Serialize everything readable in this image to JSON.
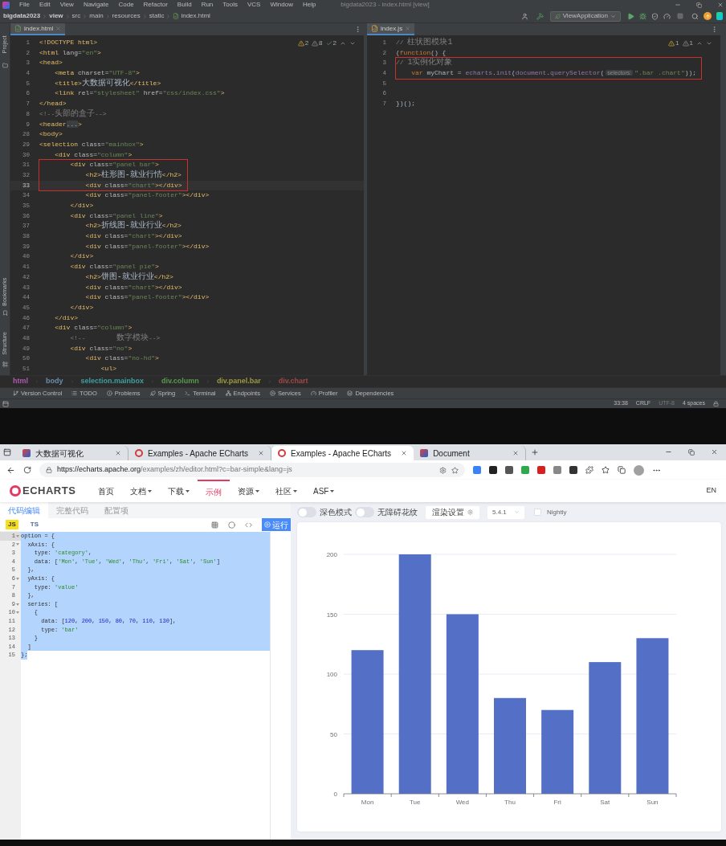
{
  "ide": {
    "menu": [
      "File",
      "Edit",
      "View",
      "Navigate",
      "Code",
      "Refactor",
      "Build",
      "Run",
      "Tools",
      "VCS",
      "Window",
      "Help"
    ],
    "window_title": "bigdata2023 - index.html [view]",
    "path": [
      "bigdata2023",
      "view",
      "src",
      "main",
      "resources",
      "static",
      "index.html"
    ],
    "run_config": "ViewApplication",
    "side_tools": [
      "Project",
      "Bookmarks",
      "Structure"
    ],
    "editors": [
      {
        "tab": "index.html",
        "inspections": [
          {
            "kind": "warning",
            "count": "2"
          },
          {
            "kind": "weak",
            "count": "8"
          },
          {
            "kind": "ok",
            "count": "2"
          }
        ],
        "lines": [
          {
            "number": "1",
            "current": false,
            "boxed": false,
            "segments": [
              {
                "kind": "tag",
                "text": "<!DOCTYPE html>"
              }
            ]
          },
          {
            "number": "2",
            "current": false,
            "boxed": false,
            "segments": [
              {
                "kind": "tag",
                "text": "<html"
              },
              {
                "kind": "attr",
                "text": " lang="
              },
              {
                "kind": "string",
                "text": "\"en\""
              },
              {
                "kind": "tag",
                "text": ">"
              }
            ]
          },
          {
            "number": "3",
            "current": false,
            "boxed": false,
            "segments": [
              {
                "kind": "tag",
                "text": "<head>"
              }
            ]
          },
          {
            "number": "4",
            "current": false,
            "boxed": false,
            "segments": [
              {
                "kind": "tag",
                "text": "    <meta"
              },
              {
                "kind": "attr",
                "text": " charset="
              },
              {
                "kind": "string",
                "text": "\"UTF-8\""
              },
              {
                "kind": "tag",
                "text": ">"
              }
            ]
          },
          {
            "number": "5",
            "current": false,
            "boxed": false,
            "segments": [
              {
                "kind": "tag",
                "text": "    <title>"
              },
              {
                "kind": "text",
                "text": "大数据可视化"
              },
              {
                "kind": "tag",
                "text": "</title>"
              }
            ]
          },
          {
            "number": "6",
            "current": false,
            "boxed": false,
            "segments": [
              {
                "kind": "tag",
                "text": "    <link"
              },
              {
                "kind": "attr",
                "text": " rel="
              },
              {
                "kind": "string",
                "text": "\"stylesheet\""
              },
              {
                "kind": "attr",
                "text": " href="
              },
              {
                "kind": "string",
                "text": "\"css/index.css\""
              },
              {
                "kind": "tag",
                "text": ">"
              }
            ]
          },
          {
            "number": "7",
            "current": false,
            "boxed": false,
            "segments": [
              {
                "kind": "tag",
                "text": "</head>"
              }
            ]
          },
          {
            "number": "8",
            "current": false,
            "boxed": false,
            "segments": [
              {
                "kind": "comment",
                "text": "<!--"
              },
              {
                "kind": "comment_text",
                "text": "头部的盒子"
              },
              {
                "kind": "comment",
                "text": "-->"
              }
            ]
          },
          {
            "number": "9",
            "current": false,
            "boxed": false,
            "segments": [
              {
                "kind": "tag",
                "text": "<header"
              },
              {
                "kind": "fold",
                "text": "..."
              },
              {
                "kind": "tag",
                "text": ">"
              }
            ]
          },
          {
            "number": "28",
            "current": false,
            "boxed": false,
            "segments": [
              {
                "kind": "tag",
                "text": "<body>"
              }
            ]
          },
          {
            "number": "29",
            "current": false,
            "boxed": false,
            "segments": [
              {
                "kind": "tag",
                "text": "<selection"
              },
              {
                "kind": "attr",
                "text": " class="
              },
              {
                "kind": "string",
                "text": "\"mainbox\""
              },
              {
                "kind": "tag",
                "text": ">"
              }
            ]
          },
          {
            "number": "30",
            "current": false,
            "boxed": false,
            "segments": [
              {
                "kind": "tag",
                "text": "    <div"
              },
              {
                "kind": "attr",
                "text": " class="
              },
              {
                "kind": "string",
                "text": "\"column\""
              },
              {
                "kind": "tag",
                "text": ">"
              }
            ]
          },
          {
            "number": "31",
            "current": false,
            "boxed": true,
            "segments": [
              {
                "kind": "tag",
                "text": "        <div"
              },
              {
                "kind": "attr",
                "text": " class="
              },
              {
                "kind": "string",
                "text": "\"panel bar\""
              },
              {
                "kind": "tag",
                "text": ">"
              }
            ]
          },
          {
            "number": "32",
            "current": false,
            "boxed": true,
            "segments": [
              {
                "kind": "tag",
                "text": "            <h2>"
              },
              {
                "kind": "text",
                "text": "柱形图-就业行情"
              },
              {
                "kind": "tag",
                "text": "</h2>"
              }
            ]
          },
          {
            "number": "33",
            "current": true,
            "boxed": true,
            "segments": [
              {
                "kind": "tag",
                "text": "            <div"
              },
              {
                "kind": "attr",
                "text": " class="
              },
              {
                "kind": "string",
                "text": "\"chart\""
              },
              {
                "kind": "tag",
                "text": "></div>"
              }
            ]
          },
          {
            "number": "34",
            "current": false,
            "boxed": false,
            "segments": [
              {
                "kind": "tag",
                "text": "            <div"
              },
              {
                "kind": "attr",
                "text": " class="
              },
              {
                "kind": "string",
                "text": "\"panel-footer\""
              },
              {
                "kind": "tag",
                "text": "></div>"
              }
            ]
          },
          {
            "number": "35",
            "current": false,
            "boxed": false,
            "segments": [
              {
                "kind": "tag",
                "text": "        </div>"
              }
            ]
          },
          {
            "number": "36",
            "current": false,
            "boxed": false,
            "segments": [
              {
                "kind": "tag",
                "text": "        <div"
              },
              {
                "kind": "attr",
                "text": " class="
              },
              {
                "kind": "string",
                "text": "\"panel line\""
              },
              {
                "kind": "tag",
                "text": ">"
              }
            ]
          },
          {
            "number": "37",
            "current": false,
            "boxed": false,
            "segments": [
              {
                "kind": "tag",
                "text": "            <h2>"
              },
              {
                "kind": "text",
                "text": "折线图-就业行业"
              },
              {
                "kind": "tag",
                "text": "</h2>"
              }
            ]
          },
          {
            "number": "38",
            "current": false,
            "boxed": false,
            "segments": [
              {
                "kind": "tag",
                "text": "            <div"
              },
              {
                "kind": "attr",
                "text": " class="
              },
              {
                "kind": "string",
                "text": "\"chart\""
              },
              {
                "kind": "tag",
                "text": "></div>"
              }
            ]
          },
          {
            "number": "39",
            "current": false,
            "boxed": false,
            "segments": [
              {
                "kind": "tag",
                "text": "            <div"
              },
              {
                "kind": "attr",
                "text": " class="
              },
              {
                "kind": "string",
                "text": "\"panel-footer\""
              },
              {
                "kind": "tag",
                "text": "></div>"
              }
            ]
          },
          {
            "number": "40",
            "current": false,
            "boxed": false,
            "segments": [
              {
                "kind": "tag",
                "text": "        </div>"
              }
            ]
          },
          {
            "number": "41",
            "current": false,
            "boxed": false,
            "segments": [
              {
                "kind": "tag",
                "text": "        <div"
              },
              {
                "kind": "attr",
                "text": " class="
              },
              {
                "kind": "string",
                "text": "\"panel pie\""
              },
              {
                "kind": "tag",
                "text": ">"
              }
            ]
          },
          {
            "number": "42",
            "current": false,
            "boxed": false,
            "segments": [
              {
                "kind": "tag",
                "text": "            <h2>"
              },
              {
                "kind": "text",
                "text": "饼图-就业行业"
              },
              {
                "kind": "tag",
                "text": "</h2>"
              }
            ]
          },
          {
            "number": "43",
            "current": false,
            "boxed": false,
            "segments": [
              {
                "kind": "tag",
                "text": "            <div"
              },
              {
                "kind": "attr",
                "text": " class="
              },
              {
                "kind": "string",
                "text": "\"chart\""
              },
              {
                "kind": "tag",
                "text": "></div>"
              }
            ]
          },
          {
            "number": "44",
            "current": false,
            "boxed": false,
            "segments": [
              {
                "kind": "tag",
                "text": "            <div"
              },
              {
                "kind": "attr",
                "text": " class="
              },
              {
                "kind": "string",
                "text": "\"panel-footer\""
              },
              {
                "kind": "tag",
                "text": "></div>"
              }
            ]
          },
          {
            "number": "45",
            "current": false,
            "boxed": false,
            "segments": [
              {
                "kind": "tag",
                "text": "        </div>"
              }
            ]
          },
          {
            "number": "46",
            "current": false,
            "boxed": false,
            "segments": [
              {
                "kind": "tag",
                "text": "    </div>"
              }
            ]
          },
          {
            "number": "47",
            "current": false,
            "boxed": false,
            "segments": [
              {
                "kind": "tag",
                "text": "    <div"
              },
              {
                "kind": "attr",
                "text": " class="
              },
              {
                "kind": "string",
                "text": "\"column\""
              },
              {
                "kind": "tag",
                "text": ">"
              }
            ]
          },
          {
            "number": "48",
            "current": false,
            "boxed": false,
            "segments": [
              {
                "kind": "comment",
                "text": "        <!--        "
              },
              {
                "kind": "comment_text",
                "text": "数字模块"
              },
              {
                "kind": "comment",
                "text": "-->"
              }
            ]
          },
          {
            "number": "49",
            "current": false,
            "boxed": false,
            "segments": [
              {
                "kind": "tag",
                "text": "        <div"
              },
              {
                "kind": "attr",
                "text": " class="
              },
              {
                "kind": "string",
                "text": "\"no\""
              },
              {
                "kind": "tag",
                "text": ">"
              }
            ]
          },
          {
            "number": "50",
            "current": false,
            "boxed": false,
            "segments": [
              {
                "kind": "tag",
                "text": "            <div"
              },
              {
                "kind": "attr",
                "text": " class="
              },
              {
                "kind": "string",
                "text": "\"no-hd\""
              },
              {
                "kind": "tag",
                "text": ">"
              }
            ]
          },
          {
            "number": "51",
            "current": false,
            "boxed": false,
            "segments": [
              {
                "kind": "tag",
                "text": "                <ul>"
              }
            ]
          }
        ]
      },
      {
        "tab": "index.js",
        "inspections": [
          {
            "kind": "warning",
            "count": "1"
          },
          {
            "kind": "weak",
            "count": "1"
          }
        ],
        "lines": [
          {
            "number": "1",
            "current": false,
            "boxed": false,
            "segments": [
              {
                "kind": "comment",
                "text": "// "
              },
              {
                "kind": "comment_text",
                "text": "柱状图模块1"
              }
            ]
          },
          {
            "number": "2",
            "current": false,
            "boxed": false,
            "segments": [
              {
                "kind": "punct",
                "text": "("
              },
              {
                "kind": "keyword",
                "text": "function"
              },
              {
                "kind": "punct",
                "text": "() {"
              }
            ]
          },
          {
            "number": "3",
            "current": false,
            "boxed": true,
            "segments": [
              {
                "kind": "comment",
                "text": "// "
              },
              {
                "kind": "comment_text",
                "text": "1实例化对象"
              }
            ]
          },
          {
            "number": "4",
            "current": false,
            "boxed": true,
            "segments": [
              {
                "kind": "keyword",
                "text": "    var"
              },
              {
                "kind": "punct",
                "text": " myChart = "
              },
              {
                "kind": "object",
                "text": "echarts"
              },
              {
                "kind": "punct",
                "text": "."
              },
              {
                "kind": "object",
                "text": "init"
              },
              {
                "kind": "punct",
                "text": "("
              },
              {
                "kind": "object",
                "text": "document"
              },
              {
                "kind": "punct",
                "text": "."
              },
              {
                "kind": "object",
                "text": "querySelector"
              },
              {
                "kind": "punct",
                "text": "("
              },
              {
                "kind": "hint",
                "text": "selectors:"
              },
              {
                "kind": "string",
                "text": "\".bar .chart\""
              },
              {
                "kind": "punct",
                "text": "));"
              }
            ]
          },
          {
            "number": "5",
            "current": false,
            "boxed": false
          },
          {
            "number": "6",
            "current": false,
            "boxed": false
          },
          {
            "number": "7",
            "current": false,
            "boxed": false,
            "segments": [
              {
                "kind": "punct",
                "text": "})();"
              }
            ]
          }
        ]
      }
    ],
    "structure_path": [
      {
        "text": "html",
        "color": "#b05ab0"
      },
      {
        "text": "body",
        "color": "#6a8cb0"
      },
      {
        "text": "selection.mainbox",
        "color": "#3f9fa0"
      },
      {
        "text": "div.column",
        "color": "#5a9a50"
      },
      {
        "text": "div.panel.bar",
        "color": "#9a9a40"
      },
      {
        "text": "div.chart",
        "color": "#a04848"
      }
    ],
    "tool_windows": [
      "Version Control",
      "TODO",
      "Problems",
      "Spring",
      "Terminal",
      "Endpoints",
      "Services",
      "Profiler",
      "Dependencies"
    ],
    "status": [
      "33:38",
      "CRLF",
      "UTF-8",
      "4 spaces"
    ]
  },
  "browser": {
    "tabs": [
      {
        "title": "大数据可视化",
        "kind": "app",
        "selected": false
      },
      {
        "title": "Examples - Apache ECharts",
        "kind": "echarts",
        "selected": false
      },
      {
        "title": "Examples - Apache ECharts",
        "kind": "echarts",
        "selected": true
      },
      {
        "title": "Document",
        "kind": "app",
        "selected": false
      }
    ],
    "url_host": "https://echarts.apache.org",
    "url_path": "/examples/zh/editor.html?c=bar-simple&lang=js"
  },
  "site": {
    "logo": "ECHARTS",
    "nav": [
      {
        "label": "首页",
        "dropdown": false,
        "selected": false
      },
      {
        "label": "文档",
        "dropdown": true,
        "selected": false
      },
      {
        "label": "下载",
        "dropdown": true,
        "selected": false
      },
      {
        "label": "示例",
        "dropdown": false,
        "selected": true
      },
      {
        "label": "资源",
        "dropdown": true,
        "selected": false
      },
      {
        "label": "社区",
        "dropdown": true,
        "selected": false
      },
      {
        "label": "ASF",
        "dropdown": true,
        "selected": false
      }
    ],
    "language": "EN"
  },
  "editor_panel": {
    "tabs": [
      {
        "label": "代码编辑",
        "selected": true
      },
      {
        "label": "完整代码",
        "selected": false
      },
      {
        "label": "配置项",
        "selected": false
      }
    ],
    "languages": [
      {
        "label": "JS",
        "selected": true
      },
      {
        "label": "TS",
        "selected": false
      }
    ],
    "run_button": "运行",
    "all_selected": true,
    "lines": [
      {
        "number": "1",
        "foldable": true,
        "segments": [
          {
            "kind": "plain",
            "text": "option = {"
          }
        ]
      },
      {
        "number": "2",
        "foldable": true,
        "segments": [
          {
            "kind": "plain",
            "text": "  xAxis: {"
          }
        ]
      },
      {
        "number": "3",
        "foldable": false,
        "segments": [
          {
            "kind": "plain",
            "text": "    type: "
          },
          {
            "kind": "string",
            "text": "'category'"
          },
          {
            "kind": "plain",
            "text": ","
          }
        ]
      },
      {
        "number": "4",
        "foldable": false,
        "segments": [
          {
            "kind": "plain",
            "text": "    data: ["
          },
          {
            "kind": "string",
            "text": "'Mon'"
          },
          {
            "kind": "plain",
            "text": ", "
          },
          {
            "kind": "string",
            "text": "'Tue'"
          },
          {
            "kind": "plain",
            "text": ", "
          },
          {
            "kind": "string",
            "text": "'Wed'"
          },
          {
            "kind": "plain",
            "text": ", "
          },
          {
            "kind": "string",
            "text": "'Thu'"
          },
          {
            "kind": "plain",
            "text": ", "
          },
          {
            "kind": "string",
            "text": "'Fri'"
          },
          {
            "kind": "plain",
            "text": ", "
          },
          {
            "kind": "string",
            "text": "'Sat'"
          },
          {
            "kind": "plain",
            "text": ", "
          },
          {
            "kind": "string",
            "text": "'Sun'"
          },
          {
            "kind": "plain",
            "text": "]"
          }
        ]
      },
      {
        "number": "5",
        "foldable": false,
        "segments": [
          {
            "kind": "plain",
            "text": "  },"
          }
        ]
      },
      {
        "number": "6",
        "foldable": true,
        "segments": [
          {
            "kind": "plain",
            "text": "  yAxis: {"
          }
        ]
      },
      {
        "number": "7",
        "foldable": false,
        "segments": [
          {
            "kind": "plain",
            "text": "    type: "
          },
          {
            "kind": "string",
            "text": "'value'"
          }
        ]
      },
      {
        "number": "8",
        "foldable": false,
        "segments": [
          {
            "kind": "plain",
            "text": "  },"
          }
        ]
      },
      {
        "number": "9",
        "foldable": true,
        "segments": [
          {
            "kind": "plain",
            "text": "  series: ["
          }
        ]
      },
      {
        "number": "10",
        "foldable": true,
        "segments": [
          {
            "kind": "plain",
            "text": "    {"
          }
        ]
      },
      {
        "number": "11",
        "foldable": false,
        "segments": [
          {
            "kind": "plain",
            "text": "      data: ["
          },
          {
            "kind": "number",
            "text": "120"
          },
          {
            "kind": "plain",
            "text": ", "
          },
          {
            "kind": "number",
            "text": "200"
          },
          {
            "kind": "plain",
            "text": ", "
          },
          {
            "kind": "number",
            "text": "150"
          },
          {
            "kind": "plain",
            "text": ", "
          },
          {
            "kind": "number",
            "text": "80"
          },
          {
            "kind": "plain",
            "text": ", "
          },
          {
            "kind": "number",
            "text": "70"
          },
          {
            "kind": "plain",
            "text": ", "
          },
          {
            "kind": "number",
            "text": "110"
          },
          {
            "kind": "plain",
            "text": ", "
          },
          {
            "kind": "number",
            "text": "130"
          },
          {
            "kind": "plain",
            "text": "],"
          }
        ]
      },
      {
        "number": "12",
        "foldable": false,
        "segments": [
          {
            "kind": "plain",
            "text": "      type: "
          },
          {
            "kind": "string",
            "text": "'bar'"
          }
        ]
      },
      {
        "number": "13",
        "foldable": false,
        "segments": [
          {
            "kind": "plain",
            "text": "    }"
          }
        ]
      },
      {
        "number": "14",
        "foldable": false,
        "segments": [
          {
            "kind": "plain",
            "text": "  ]"
          }
        ]
      },
      {
        "number": "15",
        "foldable": false,
        "segments": [
          {
            "kind": "plain",
            "text": "};"
          }
        ]
      }
    ]
  },
  "preview": {
    "toggles": [
      {
        "label": "深色模式",
        "on": false
      },
      {
        "label": "无障碍花纹",
        "on": false
      }
    ],
    "render_button": "渲染设置",
    "version": "5.4.1",
    "nightly": {
      "label": "Nightly",
      "checked": false
    },
    "chart_data": {
      "type": "bar",
      "categories": [
        "Mon",
        "Tue",
        "Wed",
        "Thu",
        "Fri",
        "Sat",
        "Sun"
      ],
      "series": [
        {
          "color": "#5470c6",
          "values": [
            120,
            200,
            150,
            80,
            70,
            110,
            130
          ]
        }
      ],
      "ylim": [
        0,
        200
      ],
      "grid": true,
      "yticks": [
        0,
        50,
        100,
        150,
        200
      ]
    }
  }
}
